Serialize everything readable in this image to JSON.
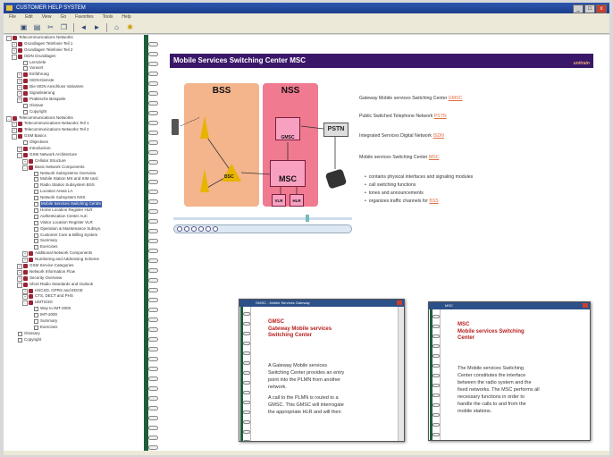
{
  "window": {
    "title": "CUSTOMER HELP SYSTEM",
    "min": "_",
    "max": "□",
    "close": "x"
  },
  "menu": [
    "File",
    "Edit",
    "View",
    "Go",
    "Favorites",
    "Tools",
    "Help"
  ],
  "toolbar": {
    "icons": [
      "save-icon",
      "print-icon",
      "cut-icon",
      "copy-icon",
      "back-icon",
      "forward-icon",
      "home-icon",
      "options-icon"
    ]
  },
  "tree": [
    {
      "indent": 0,
      "exp": "-",
      "icon": "book",
      "label": "Telecommunications Networks"
    },
    {
      "indent": 1,
      "exp": "+",
      "icon": "book",
      "label": "Grundlagen Telefonie Teil 1"
    },
    {
      "indent": 1,
      "exp": "+",
      "icon": "book",
      "label": "Grundlagen Telefonie Teil 2"
    },
    {
      "indent": 1,
      "exp": "-",
      "icon": "book",
      "label": "ISDN Grundlagen"
    },
    {
      "indent": 2,
      "exp": "",
      "icon": "page",
      "label": "Lernziele"
    },
    {
      "indent": 2,
      "exp": "",
      "icon": "page",
      "label": "Vorwort"
    },
    {
      "indent": 2,
      "exp": "+",
      "icon": "book",
      "label": "Einführung"
    },
    {
      "indent": 2,
      "exp": "+",
      "icon": "book",
      "label": "ISDN-Dienste"
    },
    {
      "indent": 2,
      "exp": "+",
      "icon": "book",
      "label": "Die ISDN Anschluss Varianten"
    },
    {
      "indent": 2,
      "exp": "+",
      "icon": "book",
      "label": "Signalisierung"
    },
    {
      "indent": 2,
      "exp": "+",
      "icon": "book",
      "label": "Praktische Beispiele"
    },
    {
      "indent": 2,
      "exp": "",
      "icon": "page",
      "label": "Glossar"
    },
    {
      "indent": 2,
      "exp": "",
      "icon": "page",
      "label": "Copyright"
    },
    {
      "indent": 0,
      "exp": "-",
      "icon": "book",
      "label": "Telecommunications Networks"
    },
    {
      "indent": 1,
      "exp": "+",
      "icon": "book",
      "label": "Telecommunications Networks Teil 1"
    },
    {
      "indent": 1,
      "exp": "+",
      "icon": "book",
      "label": "Telecommunications Networks Teil 2"
    },
    {
      "indent": 1,
      "exp": "-",
      "icon": "book",
      "label": "GSM Basics"
    },
    {
      "indent": 2,
      "exp": "",
      "icon": "page",
      "label": "Objectives"
    },
    {
      "indent": 2,
      "exp": "+",
      "icon": "book",
      "label": "Introduction"
    },
    {
      "indent": 2,
      "exp": "-",
      "icon": "book",
      "label": "GSM Network Architecture"
    },
    {
      "indent": 3,
      "exp": "+",
      "icon": "book",
      "label": "Cellular Structure"
    },
    {
      "indent": 3,
      "exp": "-",
      "icon": "book",
      "label": "Basic Network Components"
    },
    {
      "indent": 4,
      "exp": "",
      "icon": "page",
      "label": "Network Subsystems Overview"
    },
    {
      "indent": 4,
      "exp": "",
      "icon": "page",
      "label": "Mobile Station MS and SIM card"
    },
    {
      "indent": 4,
      "exp": "",
      "icon": "page",
      "label": "Radio Station Subsystem BSS"
    },
    {
      "indent": 4,
      "exp": "",
      "icon": "page",
      "label": "Location Areas LA"
    },
    {
      "indent": 4,
      "exp": "",
      "icon": "page",
      "label": "Network Subsystem NSS"
    },
    {
      "indent": 4,
      "exp": "",
      "icon": "page",
      "label": "Mobile Services Switching Centre",
      "sel": true
    },
    {
      "indent": 4,
      "exp": "",
      "icon": "page",
      "label": "Home Location Register HLR"
    },
    {
      "indent": 4,
      "exp": "",
      "icon": "page",
      "label": "Authentication Center AuC"
    },
    {
      "indent": 4,
      "exp": "",
      "icon": "page",
      "label": "Visitor Location Register VLR"
    },
    {
      "indent": 4,
      "exp": "",
      "icon": "page",
      "label": "Operation & Maintenance Subsys."
    },
    {
      "indent": 4,
      "exp": "",
      "icon": "page",
      "label": "Customer Care & Billing System"
    },
    {
      "indent": 4,
      "exp": "",
      "icon": "page",
      "label": "Summary"
    },
    {
      "indent": 4,
      "exp": "",
      "icon": "page",
      "label": "Exercises"
    },
    {
      "indent": 3,
      "exp": "+",
      "icon": "book",
      "label": "Additional Network Components"
    },
    {
      "indent": 3,
      "exp": "+",
      "icon": "book",
      "label": "Numbering and Addressing Scheme"
    },
    {
      "indent": 2,
      "exp": "+",
      "icon": "book",
      "label": "GSM Service Categories"
    },
    {
      "indent": 2,
      "exp": "+",
      "icon": "book",
      "label": "Network Information Flow"
    },
    {
      "indent": 2,
      "exp": "+",
      "icon": "book",
      "label": "Security Overview"
    },
    {
      "indent": 2,
      "exp": "-",
      "icon": "book",
      "label": "Short Radio Standards and Outlook"
    },
    {
      "indent": 3,
      "exp": "+",
      "icon": "book",
      "label": "HSCSD, GPRS and EDGE"
    },
    {
      "indent": 3,
      "exp": "+",
      "icon": "book",
      "label": "CTS, DECT and PHS"
    },
    {
      "indent": 3,
      "exp": "-",
      "icon": "book",
      "label": "UMTS/3G"
    },
    {
      "indent": 4,
      "exp": "",
      "icon": "page",
      "label": "Way to IMT-2000"
    },
    {
      "indent": 4,
      "exp": "",
      "icon": "page",
      "label": "IMT-2000"
    },
    {
      "indent": 4,
      "exp": "",
      "icon": "page",
      "label": "Summary"
    },
    {
      "indent": 4,
      "exp": "",
      "icon": "page",
      "label": "Exercises"
    },
    {
      "indent": 1,
      "exp": "",
      "icon": "page",
      "label": "Glossary"
    },
    {
      "indent": 1,
      "exp": "",
      "icon": "page",
      "label": "Copyright"
    }
  ],
  "content": {
    "title": "Mobile Services Switching Center MSC",
    "logo": "unitrain",
    "diagram": {
      "bss": "BSS",
      "nss": "NSS",
      "gmsc": "GMSC",
      "msc": "MSC",
      "vlr": "VLR",
      "hlr": "HLR",
      "bsc": "BSC",
      "pstn": "PSTN"
    },
    "items": [
      {
        "text": "Gateway Mobile services Switching Center ",
        "link": "GMSC"
      },
      {
        "text": "Public Switched Telephone Network ",
        "link": "PSTN"
      },
      {
        "text": "Integrated Services Digital Network ",
        "link": "ISDN"
      },
      {
        "text": "Mobile services Switching Center ",
        "link": "MSC"
      }
    ],
    "bullets": [
      "contains physical interfaces and signaling modules",
      "call switching functions",
      "tones and announcements",
      "organizes traffic channels for "
    ],
    "bullet_link": "BSS"
  },
  "popup_gmsc": {
    "title": "GMSC - Mobile Services Gateway",
    "heading": "GMSC\nGateway Mobile services\nSwitching Center",
    "body1": "A Gateway Mobile services\nSwitching Center provides an entry\npoint into the PLMN from another\nnetwork.",
    "body2": "A call to the PLMN is routed to a\nGMSC. This GMSC will interrogate\nthe appropriate HLR and will then"
  },
  "popup_msc": {
    "title": "MSC",
    "heading": "MSC\nMobile services Switching\nCenter",
    "body": "The Mobile services Switching\nCenter constitutes the interface\nbetween the radio system and the\nfixed networks. The MSC performs all\nnecessary functions in order to\nhandle the calls to and from the\nmobile stations."
  }
}
